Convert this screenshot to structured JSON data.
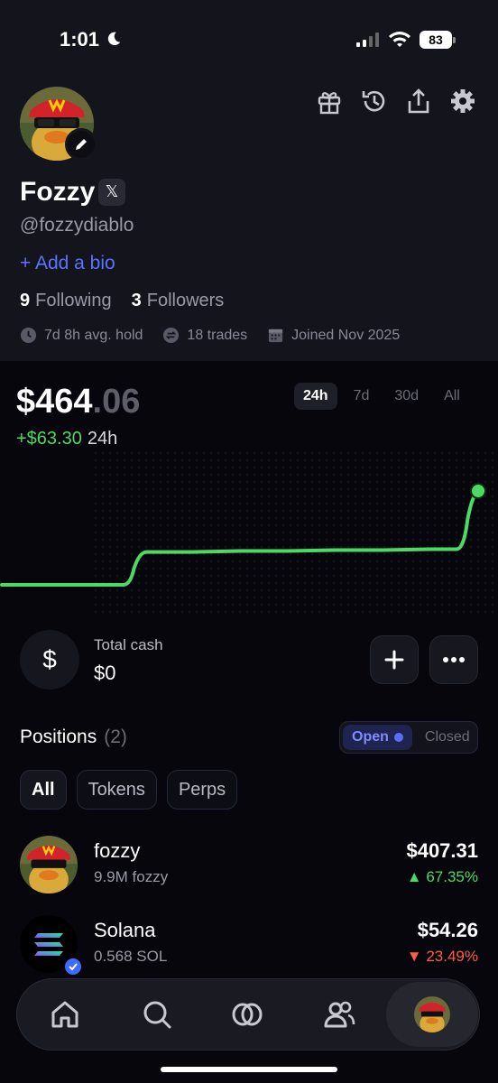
{
  "status_bar": {
    "time": "1:01",
    "battery": "83"
  },
  "profile": {
    "name": "Fozzy",
    "social_badge": "𝕏",
    "handle": "@fozzydiablo",
    "add_bio": "+ Add a bio",
    "following_count": "9",
    "following_label": "Following",
    "followers_count": "3",
    "followers_label": "Followers",
    "avg_hold": "7d 8h avg. hold",
    "trades": "18 trades",
    "joined": "Joined Nov 2025"
  },
  "balance": {
    "main": "$464",
    "cents": ".06",
    "change": "+$63.30",
    "change_period": "24h",
    "ranges": [
      "24h",
      "7d",
      "30d",
      "All"
    ],
    "active_range": "24h"
  },
  "chart_data": {
    "type": "line",
    "x": [
      0,
      1,
      2,
      3,
      4,
      5,
      6,
      7,
      8,
      9,
      10
    ],
    "values": [
      0.0,
      0.0,
      0.0,
      0.35,
      0.35,
      0.36,
      0.36,
      0.37,
      0.37,
      0.38,
      1.0
    ],
    "color": "#4cd964"
  },
  "cash": {
    "symbol": "$",
    "label": "Total cash",
    "value": "$0"
  },
  "positions": {
    "title": "Positions",
    "count": "(2)",
    "toggle_open": "Open",
    "toggle_closed": "Closed",
    "filters": [
      "All",
      "Tokens",
      "Perps"
    ],
    "items": [
      {
        "name": "fozzy",
        "amount": "9.9M fozzy",
        "value": "$407.31",
        "change": "▲ 67.35%",
        "direction": "up"
      },
      {
        "name": "Solana",
        "amount": "0.568 SOL",
        "value": "$54.26",
        "change": "▼ 23.49%",
        "direction": "down"
      }
    ]
  },
  "colors": {
    "accent_blue": "#5b73ff",
    "up_green": "#4cd964",
    "down_red": "#ff5c48"
  }
}
